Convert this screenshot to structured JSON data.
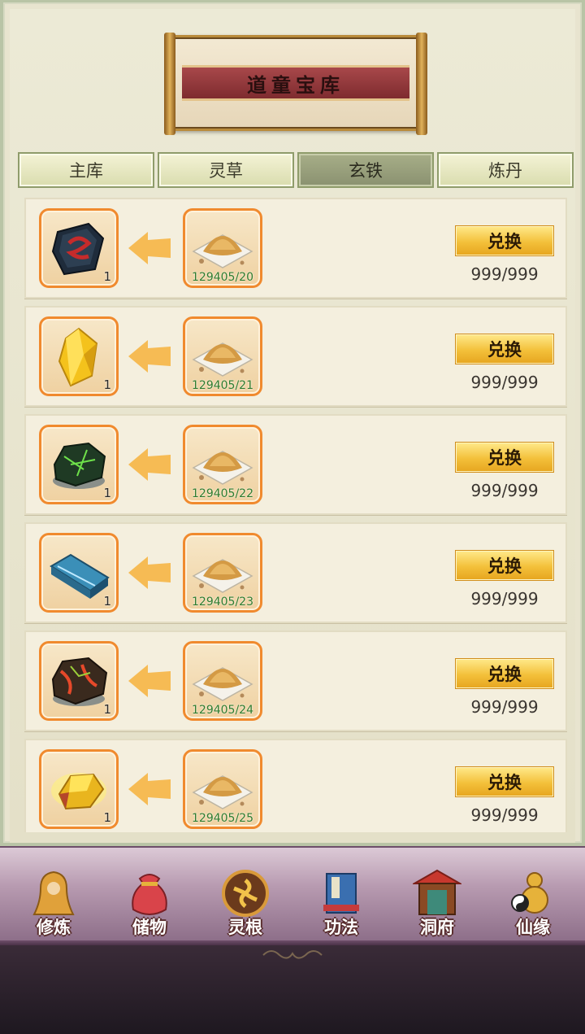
{
  "title": "道童宝库",
  "tabs": [
    {
      "label": "主库",
      "active": false
    },
    {
      "label": "灵草",
      "active": false
    },
    {
      "label": "玄铁",
      "active": true
    },
    {
      "label": "炼丹",
      "active": false
    }
  ],
  "rows": [
    {
      "reward_icon": "dark-rune-stone-icon",
      "reward_qty": "1",
      "cost_icon": "sand-pile-icon",
      "cost_qty": "129405/20",
      "button_label": "兑换",
      "stock": "999/999"
    },
    {
      "reward_icon": "yellow-crystal-icon",
      "reward_qty": "1",
      "cost_icon": "sand-pile-icon",
      "cost_qty": "129405/21",
      "button_label": "兑换",
      "stock": "999/999"
    },
    {
      "reward_icon": "green-ore-icon",
      "reward_qty": "1",
      "cost_icon": "sand-pile-icon",
      "cost_qty": "129405/22",
      "button_label": "兑换",
      "stock": "999/999"
    },
    {
      "reward_icon": "blue-ingot-icon",
      "reward_qty": "1",
      "cost_icon": "sand-pile-icon",
      "cost_qty": "129405/23",
      "button_label": "兑换",
      "stock": "999/999"
    },
    {
      "reward_icon": "red-ore-icon",
      "reward_qty": "1",
      "cost_icon": "sand-pile-icon",
      "cost_qty": "129405/24",
      "button_label": "兑换",
      "stock": "999/999"
    },
    {
      "reward_icon": "gold-nugget-icon",
      "reward_qty": "1",
      "cost_icon": "sand-pile-icon",
      "cost_qty": "129405/25",
      "button_label": "兑换",
      "stock": "999/999"
    }
  ],
  "nav": [
    {
      "label": "修炼",
      "icon": "meditating-monk-icon"
    },
    {
      "label": "储物",
      "icon": "storage-bag-icon"
    },
    {
      "label": "灵根",
      "icon": "spirit-root-icon"
    },
    {
      "label": "功法",
      "icon": "scripture-book-icon"
    },
    {
      "label": "洞府",
      "icon": "cave-palace-icon"
    },
    {
      "label": "仙缘",
      "icon": "gourd-yinyang-icon"
    }
  ],
  "colors": {
    "panel": "#e8e4cf",
    "slot_border": "#f08a2e",
    "cost_text": "#2f7d2f",
    "button": "#f3c03a",
    "title_ribbon": "#8e3538"
  }
}
